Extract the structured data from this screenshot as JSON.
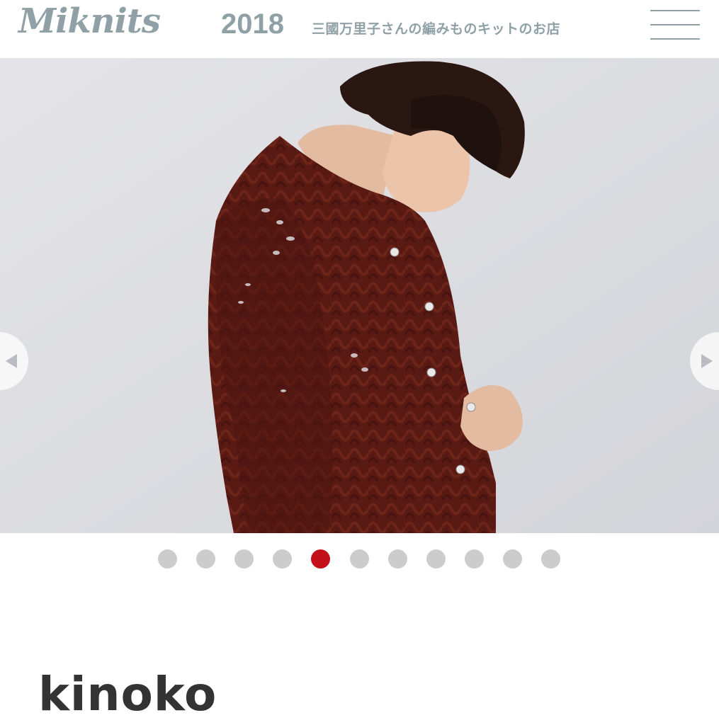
{
  "header": {
    "logo": "Miknits",
    "year": "2018",
    "tagline": "三國万里子さんの編みものキットのお店",
    "menu_icon": "hamburger-menu-icon"
  },
  "hero": {
    "image_description_icon": "photo-woman-burgundy-lace-cardigan",
    "prev_icon": "chevron-left-icon",
    "next_icon": "chevron-right-icon"
  },
  "carousel": {
    "total": 11,
    "active_index": 4,
    "dot_color": "#cccccc",
    "active_color": "#c4101b"
  },
  "product": {
    "title": "kinoko"
  },
  "colors": {
    "brand": "#8fa0a6",
    "text": "#333333",
    "accent": "#c4101b"
  }
}
